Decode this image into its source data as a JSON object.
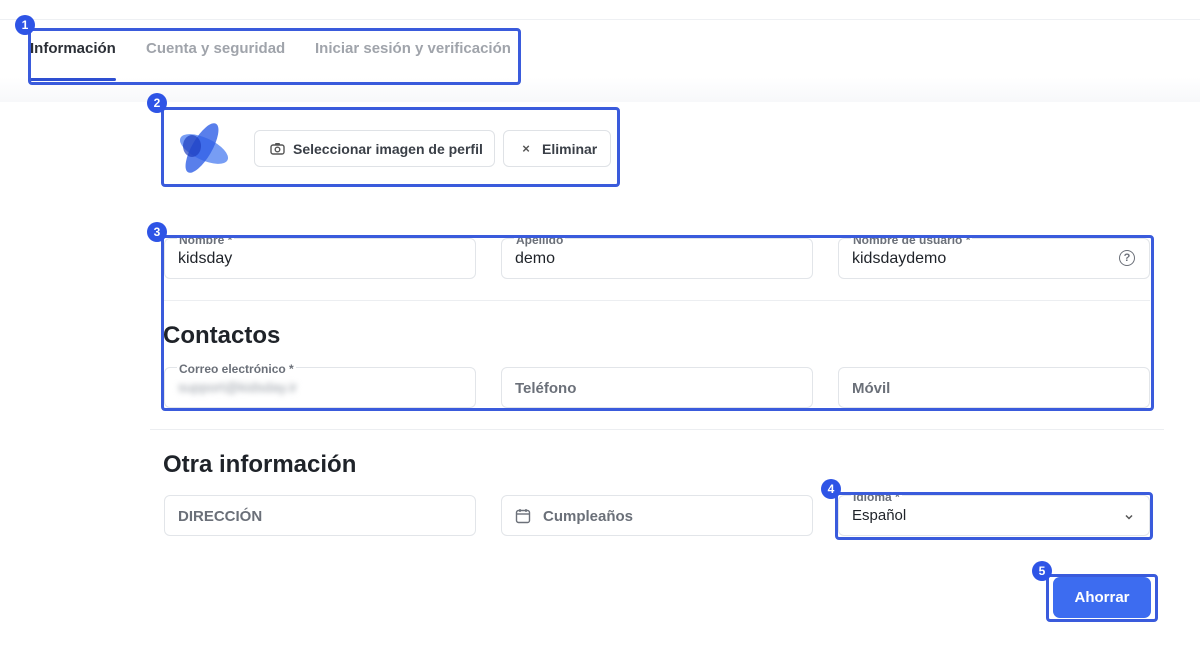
{
  "tabs": [
    {
      "label": "Información",
      "active": true
    },
    {
      "label": "Cuenta y seguridad",
      "active": false
    },
    {
      "label": "Iniciar sesión y verificación",
      "active": false
    }
  ],
  "annotations": [
    "1",
    "2",
    "3",
    "4",
    "5"
  ],
  "profile": {
    "select_image_label": "Seleccionar imagen de perfil",
    "remove_label": "Eliminar"
  },
  "fields": {
    "first_name": {
      "label": "Nombre *",
      "value": "kidsday"
    },
    "last_name": {
      "label": "Apellido",
      "value": "demo"
    },
    "username": {
      "label": "Nombre de usuario *",
      "value": "kidsdaydemo"
    }
  },
  "contacts": {
    "title": "Contactos",
    "email": {
      "label": "Correo electrónico *",
      "value": "support@kidsday.ir"
    },
    "phone_placeholder": "Teléfono",
    "mobile_placeholder": "Móvil"
  },
  "other": {
    "title": "Otra información",
    "address_placeholder": "DIRECCIÓN",
    "birthday_placeholder": "Cumpleaños",
    "language": {
      "label": "Idioma *",
      "value": "Español"
    }
  },
  "save_label": "Ahorrar",
  "colors": {
    "accent": "#3d6cf0",
    "highlight": "#3a5bdc"
  }
}
